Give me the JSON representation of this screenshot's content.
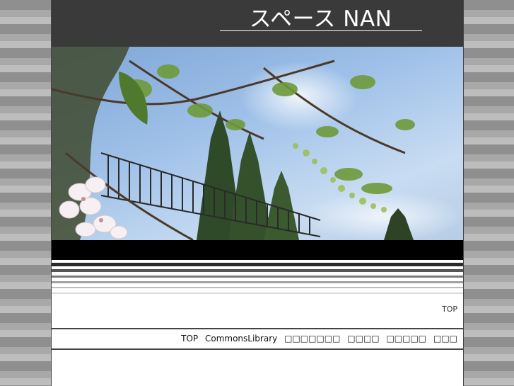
{
  "header": {
    "site_title": "スペース NAN"
  },
  "top_row": {
    "top_link": "TOP"
  },
  "nav": {
    "items": [
      {
        "label": "TOP"
      },
      {
        "label": "CommonsLibrary"
      },
      {
        "label": "□□□□□□□"
      },
      {
        "label": "□□□□"
      },
      {
        "label": "□□□□□"
      },
      {
        "label": "□□□"
      }
    ]
  },
  "colors": {
    "header_bg": "#3a3a3a",
    "band": "#000000",
    "border": "#444444"
  }
}
